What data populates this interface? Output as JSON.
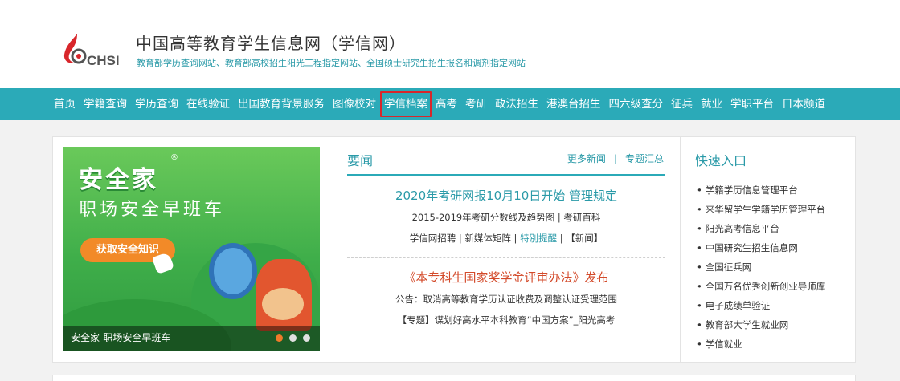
{
  "header": {
    "logo_text": "CHSI",
    "title": "中国高等教育学生信息网（学信网）",
    "subtitle": "教育部学历查询网站、教育部高校招生阳光工程指定网站、全国硕士研究生招生报名和调剂指定网站"
  },
  "nav": {
    "items": [
      {
        "label": "首页"
      },
      {
        "label": "学籍查询"
      },
      {
        "label": "学历查询"
      },
      {
        "label": "在线验证"
      },
      {
        "label": "出国教育背景服务"
      },
      {
        "label": "图像校对"
      },
      {
        "label": "学信档案",
        "highlighted": true
      },
      {
        "label": "高考"
      },
      {
        "label": "考研"
      },
      {
        "label": "政法招生"
      },
      {
        "label": "港澳台招生"
      },
      {
        "label": "四六级查分"
      },
      {
        "label": "征兵"
      },
      {
        "label": "就业"
      },
      {
        "label": "学职平台"
      },
      {
        "label": "日本频道"
      }
    ],
    "highlight_color": "#d8262b"
  },
  "banner": {
    "brand": "安全家",
    "registered_mark": "®",
    "tagline": "职场安全早班车",
    "cta_label": "获取安全知识",
    "caption": "安全家-职场安全早班车",
    "slides_count": 3,
    "active_slide": 1
  },
  "news": {
    "title": "要闻",
    "more_label": "更多新闻",
    "separator": "|",
    "topics_label": "专题汇总",
    "headline1": "2020年考研网报10月10日开始 管理规定",
    "headline1_sub1": "2015-2019年考研分数线及趋势图 | 考研百科",
    "headline1_sub2_a": "学信网招聘 | 新媒体矩阵 | ",
    "headline1_sub2_b": "特別提醒",
    "headline1_sub2_c": " | 【新闻】",
    "headline2": "《本专科生国家奖学金评审办法》发布",
    "headline2_sub1": "公告：取消高等教育学历认证收费及调整认证受理范围",
    "headline2_sub2": "【专题】谋划好高水平本科教育“中国方案”_阳光高考"
  },
  "quick": {
    "title": "快速入口",
    "items": [
      "学籍学历信息管理平台",
      "来华留学生学籍学历管理平台",
      "阳光高考信息平台",
      "中国研究生招生信息网",
      "全国征兵网",
      "全国万名优秀创新创业导师库",
      "电子成绩单验证",
      "教育部大学生就业网",
      "学信就业"
    ]
  },
  "colors": {
    "accent": "#2baab8",
    "accent_text": "#2a9aa8",
    "headline_red": "#d34a2a"
  }
}
